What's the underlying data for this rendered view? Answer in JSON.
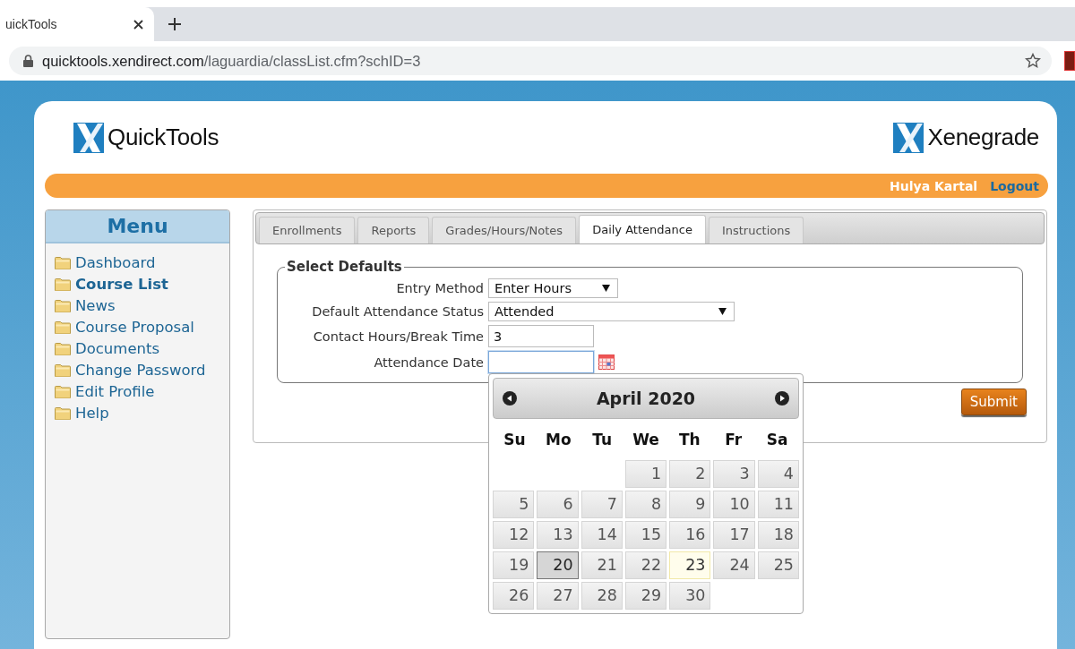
{
  "browser": {
    "tab_title": "uickTools",
    "url": {
      "host": "quicktools.xendirect.com",
      "path": "/laguardia/classList.cfm?schID=3"
    }
  },
  "header": {
    "app_logo": "QuickTools",
    "company_logo": "Xenegrade",
    "user_name": "Hulya Kartal",
    "logout": "Logout"
  },
  "menu": {
    "title": "Menu",
    "items": [
      {
        "label": "Dashboard",
        "selected": false
      },
      {
        "label": "Course List",
        "selected": true
      },
      {
        "label": "News",
        "selected": false
      },
      {
        "label": "Course Proposal",
        "selected": false
      },
      {
        "label": "Documents",
        "selected": false
      },
      {
        "label": "Change Password",
        "selected": false
      },
      {
        "label": "Edit Profile",
        "selected": false
      },
      {
        "label": "Help",
        "selected": false
      }
    ]
  },
  "tabs": [
    {
      "label": "Enrollments",
      "selected": false
    },
    {
      "label": "Reports",
      "selected": false
    },
    {
      "label": "Grades/Hours/Notes",
      "selected": false
    },
    {
      "label": "Daily Attendance",
      "selected": true
    },
    {
      "label": "Instructions",
      "selected": false
    }
  ],
  "form": {
    "legend": "Select Defaults",
    "fields": [
      {
        "label": "Entry Method",
        "kind": "select",
        "value": "Enter Hours",
        "focused": false
      },
      {
        "label": "Default Attendance Status",
        "kind": "select",
        "value": "Attended",
        "focused": false
      },
      {
        "label": "Contact Hours/Break Time",
        "kind": "text",
        "value": "3",
        "focused": false
      },
      {
        "label": "Attendance Date",
        "kind": "date",
        "focused": true
      }
    ],
    "submit": "Submit"
  },
  "calendar": {
    "title": "April 2020",
    "weekdays": [
      "Su",
      "Mo",
      "Tu",
      "We",
      "Th",
      "Fr",
      "Sa"
    ],
    "weeks": [
      {
        "kind": "partial",
        "days": [
          {
            "label": "1",
            "selected": false,
            "today": false
          },
          {
            "label": "2",
            "selected": false,
            "today": false
          },
          {
            "label": "3",
            "selected": false,
            "today": false
          },
          {
            "label": "4",
            "selected": false,
            "today": false
          }
        ]
      },
      {
        "kind": "full",
        "days": [
          {
            "label": "5",
            "selected": false,
            "today": false
          },
          {
            "label": "6",
            "selected": false,
            "today": false
          },
          {
            "label": "7",
            "selected": false,
            "today": false
          },
          {
            "label": "8",
            "selected": false,
            "today": false
          },
          {
            "label": "9",
            "selected": false,
            "today": false
          },
          {
            "label": "10",
            "selected": false,
            "today": false
          },
          {
            "label": "11",
            "selected": false,
            "today": false
          }
        ]
      },
      {
        "kind": "full",
        "days": [
          {
            "label": "12",
            "selected": false,
            "today": false
          },
          {
            "label": "13",
            "selected": false,
            "today": false
          },
          {
            "label": "14",
            "selected": false,
            "today": false
          },
          {
            "label": "15",
            "selected": false,
            "today": false
          },
          {
            "label": "16",
            "selected": false,
            "today": false
          },
          {
            "label": "17",
            "selected": false,
            "today": false
          },
          {
            "label": "18",
            "selected": false,
            "today": false
          }
        ]
      },
      {
        "kind": "full",
        "days": [
          {
            "label": "19",
            "selected": false,
            "today": false
          },
          {
            "label": "20",
            "selected": true,
            "today": false
          },
          {
            "label": "21",
            "selected": false,
            "today": false
          },
          {
            "label": "22",
            "selected": false,
            "today": false
          },
          {
            "label": "23",
            "selected": false,
            "today": true
          },
          {
            "label": "24",
            "selected": false,
            "today": false
          },
          {
            "label": "25",
            "selected": false,
            "today": false
          }
        ]
      },
      {
        "kind": "last",
        "days": [
          {
            "label": "26",
            "selected": false,
            "today": false
          },
          {
            "label": "27",
            "selected": false,
            "today": false
          },
          {
            "label": "28",
            "selected": false,
            "today": false
          },
          {
            "label": "29",
            "selected": false,
            "today": false
          },
          {
            "label": "30",
            "selected": false,
            "today": false
          }
        ]
      }
    ]
  }
}
